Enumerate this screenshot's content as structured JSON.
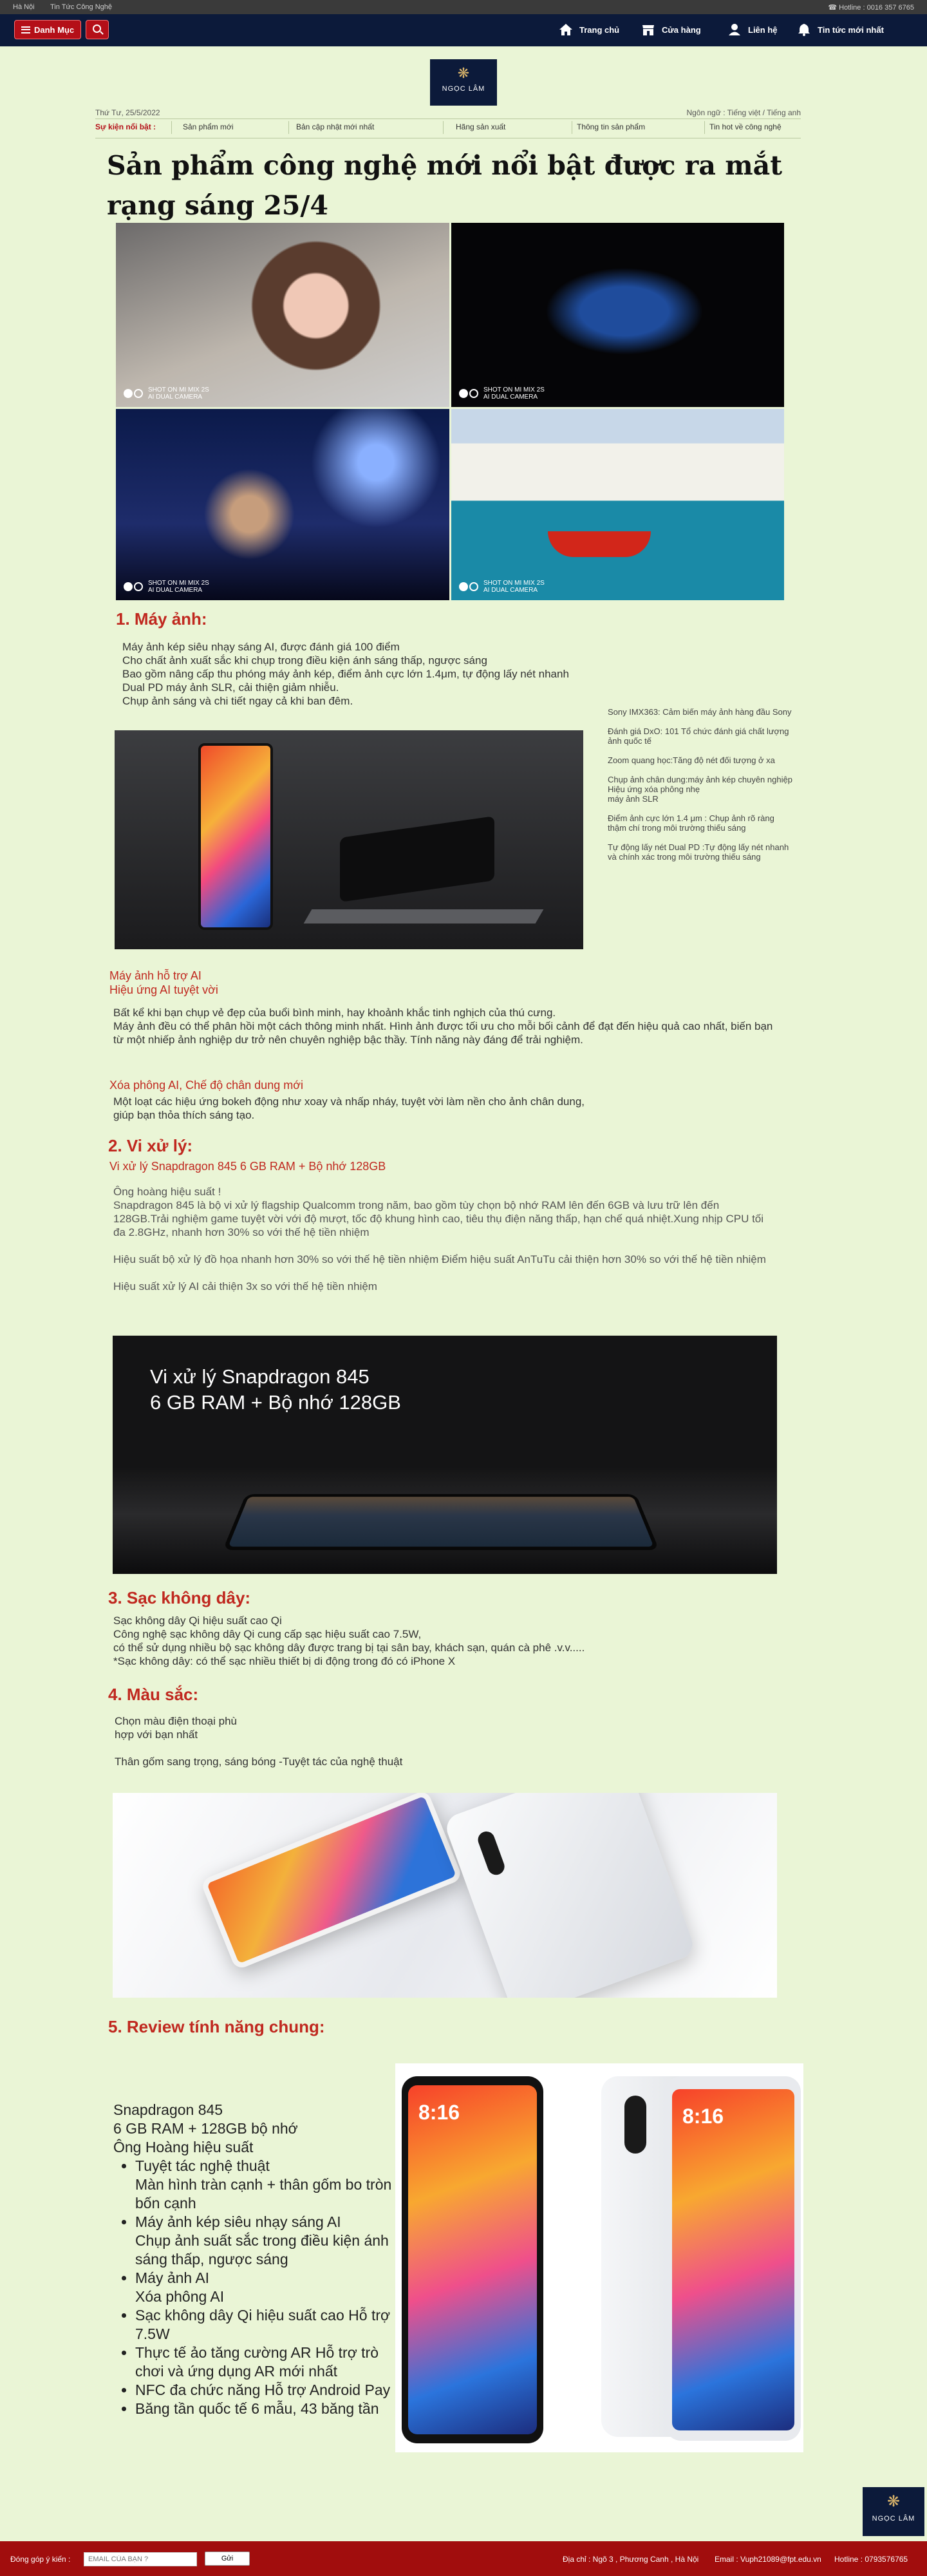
{
  "topbar": {
    "left1": "Hà Nội",
    "left2": "Tin Tức Công Nghệ",
    "hotline": "Hotline : 0016 357 6765"
  },
  "nav": {
    "menu_label": "Danh Mục",
    "items": [
      {
        "label": "Trang chủ",
        "icon": "home-icon"
      },
      {
        "label": "Cửa hàng",
        "icon": "store-icon"
      },
      {
        "label": "Liên hệ",
        "icon": "user-icon"
      },
      {
        "label": "Tin tức mới nhất",
        "icon": "bell-icon"
      }
    ]
  },
  "logo": {
    "name": "NGỌC LÂM"
  },
  "date": "Thứ Tư, 25/5/2022",
  "language": {
    "label": "Ngôn ngữ :",
    "opt1": "Tiếng việt",
    "sep": "/",
    "opt2": "Tiếng anh"
  },
  "events": {
    "label": "Sự kiện nổi bật :",
    "items": [
      "Sản phẩm mới",
      "Bản cập nhật mới nhất",
      "Hãng sản xuất",
      "Thông tin sản phẩm",
      "Tin hot về công nghệ"
    ]
  },
  "article": {
    "title": "Sản phẩm công nghệ mới nổi bật được ra mắt rạng sáng 25/4",
    "photo_caption": "SHOT ON MI MIX 2S\nAI DUAL CAMERA",
    "section1": {
      "heading": "1. Máy ảnh:",
      "text": "Máy ảnh kép siêu nhạy sáng AI, được đánh giá 100 điểm\nCho chất ảnh xuất sắc khi chụp trong điều kiện ánh sáng thấp, ngược sáng\nBao gồm nâng cấp thu phóng máy ảnh kép, điểm ảnh cực lớn 1.4μm, tự động lấy nét nhanh\nDual PD máy ảnh SLR, cải thiện giảm nhiễu.\nChụp ảnh sáng và chi tiết ngay cả khi ban đêm.",
      "side": [
        "Sony IMX363: Cảm biến máy ảnh hàng đầu Sony",
        "Đánh giá DxO: 101 Tổ chức đánh giá chất lượng ảnh quốc tế",
        "Zoom quang học:Tăng độ nét đối tượng ở xa",
        "Chụp ảnh chân dung:máy ảnh kép chuyên nghiệp Hiệu ứng xóa phông nhẹ\nmáy ảnh SLR",
        "Điểm ảnh cực lớn 1.4 μm : Chụp ảnh rõ ràng thậm chí trong môi trường thiếu sáng",
        "Tự động lấy nét Dual PD :Tự động lấy nét nhanh và chính xác trong môi trường thiếu sáng"
      ],
      "sub1": "Máy ảnh hỗ trợ AI\nHiệu ứng AI tuyệt vời",
      "sub1_text": "Bất kể khi bạn chụp vẻ đẹp của buổi bình minh, hay khoảnh khắc tinh nghịch của thú cưng.\nMáy ảnh đều có thể phân hồi một cách thông minh nhất. Hình ảnh được tối ưu cho mỗi bối cảnh để đạt đến hiệu quả cao nhất, biến bạn từ một nhiếp ảnh nghiệp dư trở nên chuyên nghiệp bậc thầy. Tính năng này đáng để trải nghiệm.",
      "sub2": "Xóa phông AI, Chế độ chân dung mới",
      "sub2_text": "Một loạt các hiệu ứng bokeh động như xoay và nhấp nháy, tuyệt vời làm nền cho ảnh chân dung,\ngiúp bạn thỏa thích sáng tạo."
    },
    "section2": {
      "heading": "2. Vi xử lý:",
      "sub": "Vi xử lý Snapdragon 845 6 GB RAM + Bộ nhớ 128GB",
      "text": "Ông hoàng hiệu suất !\nSnapdragon 845 là bộ vi xử lý flagship Qualcomm trong năm,  bao gồm tùy chọn bộ nhớ RAM lên đến 6GB và lưu trữ lên đến 128GB.Trải nghiệm game tuyệt vời với độ mượt, tốc độ khung hình cao, tiêu thụ điện năng thấp, hạn chế quá nhiệt.Xung nhịp CPU tối đa 2.8GHz, nhanh hơn 30% so với thế hệ tiền nhiệm\n\nHiệu suất bộ xử lý đồ họa nhanh hơn 30% so với thế hệ tiền nhiệm Điểm hiệu suất AnTuTu cải thiện hơn 30% so với thế hệ tiền nhiệm\n\nHiệu suất xử lý AI cải thiện 3x so với thế hệ tiền nhiệm",
      "banner": "Vi xử lý Snapdragon 845\n6 GB RAM + Bộ nhớ 128GB"
    },
    "section3": {
      "heading": "3. Sạc không dây:",
      "text": "Sạc không dây Qi hiệu suất cao Qi\nCông nghệ sạc không dây Qi cung cấp sạc hiệu suất cao 7.5W,\ncó thể sử dụng nhiều bộ sạc không dây được trang bị tại sân bay, khách sạn, quán cà phê .v.v.....\n*Sạc không dây: có thể sạc nhiều thiết bị di động trong đó có iPhone X"
    },
    "section4": {
      "heading": "4. Màu sắc:",
      "text": "Chọn màu điện thoại phù\nhợp với bạn nhất\n\nThân gốm sang trọng, sáng bóng -Tuyệt tác của nghệ thuật"
    },
    "section5": {
      "heading": "5. Review tính năng chung:",
      "intro": "Snapdragon 845\n6 GB RAM + 128GB bộ nhớ\nÔng Hoàng hiệu suất",
      "items": [
        "Tuyệt tác nghệ thuật\nMàn hình tràn cạnh + thân gốm bo tròn bốn cạnh",
        "Máy ảnh kép siêu nhạy sáng AI\nChụp ảnh suất sắc trong điều kiện ánh sáng thấp, ngược sáng",
        "Máy ảnh AI\nXóa phông AI",
        "Sạc không dây Qi hiệu suất cao  Hỗ trợ 7.5W",
        "Thực tế ảo tăng cường AR Hỗ trợ  trò chơi và ứng dụng AR mới nhất",
        "NFC đa chức năng Hỗ trợ Android Pay",
        "Băng tần quốc tế 6 mẫu, 43 băng tần"
      ],
      "phone_time": "8:16"
    }
  },
  "footer": {
    "feedback_label": "Đóng góp ý kiến :",
    "email_placeholder": "EMAIL CỦA BẠN ?",
    "submit": "Gửi",
    "address": "Địa chỉ : Ngõ 3 , Phương Canh , Hà Nội",
    "email": "Email : Vuph21089@fpt.edu.vn",
    "hotline": "Hotline : 0793576765"
  },
  "colors": {
    "nav_bg": "#0c1a3a",
    "accent_red": "#b40f18",
    "heading_red": "#c0281f",
    "page_bg": "#eaf5d6",
    "footer_bg": "#a10d0d"
  }
}
